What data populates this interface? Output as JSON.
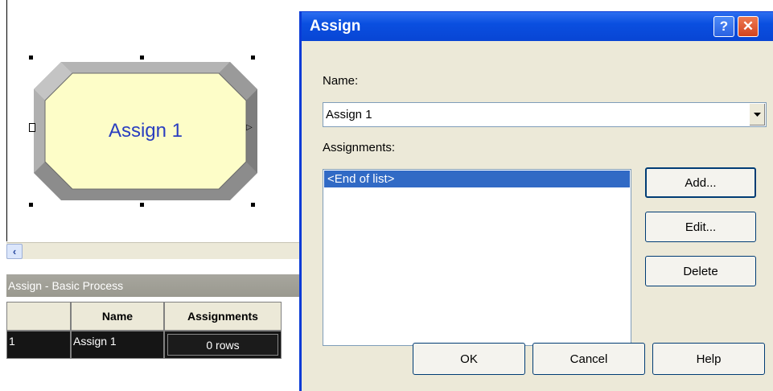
{
  "canvas": {
    "module_label": "Assign 1"
  },
  "spreadsheet": {
    "title": "Assign - Basic Process",
    "columns": [
      "",
      "Name",
      "Assignments"
    ],
    "rows": [
      {
        "index": "1",
        "name": "Assign 1",
        "assignments": "0 rows"
      }
    ]
  },
  "dialog": {
    "title": "Assign",
    "help_glyph": "?",
    "close_glyph": "✕",
    "name_label": "Name:",
    "name_value": "Assign 1",
    "assignments_label": "Assignments:",
    "assignments_items": [
      "<End of list>"
    ],
    "buttons": {
      "add": "Add...",
      "edit": "Edit...",
      "delete": "Delete",
      "ok": "OK",
      "cancel": "Cancel",
      "help": "Help"
    }
  },
  "colors": {
    "module_fill": "#fdfdc8",
    "module_label": "#2a3ec0",
    "titlebar": "#0a4fe0",
    "selection": "#316ac5"
  },
  "icons": {
    "scroll_left": "left-arrow-icon",
    "combo_arrow": "dropdown-arrow-icon",
    "help": "help-icon",
    "close": "close-icon"
  }
}
